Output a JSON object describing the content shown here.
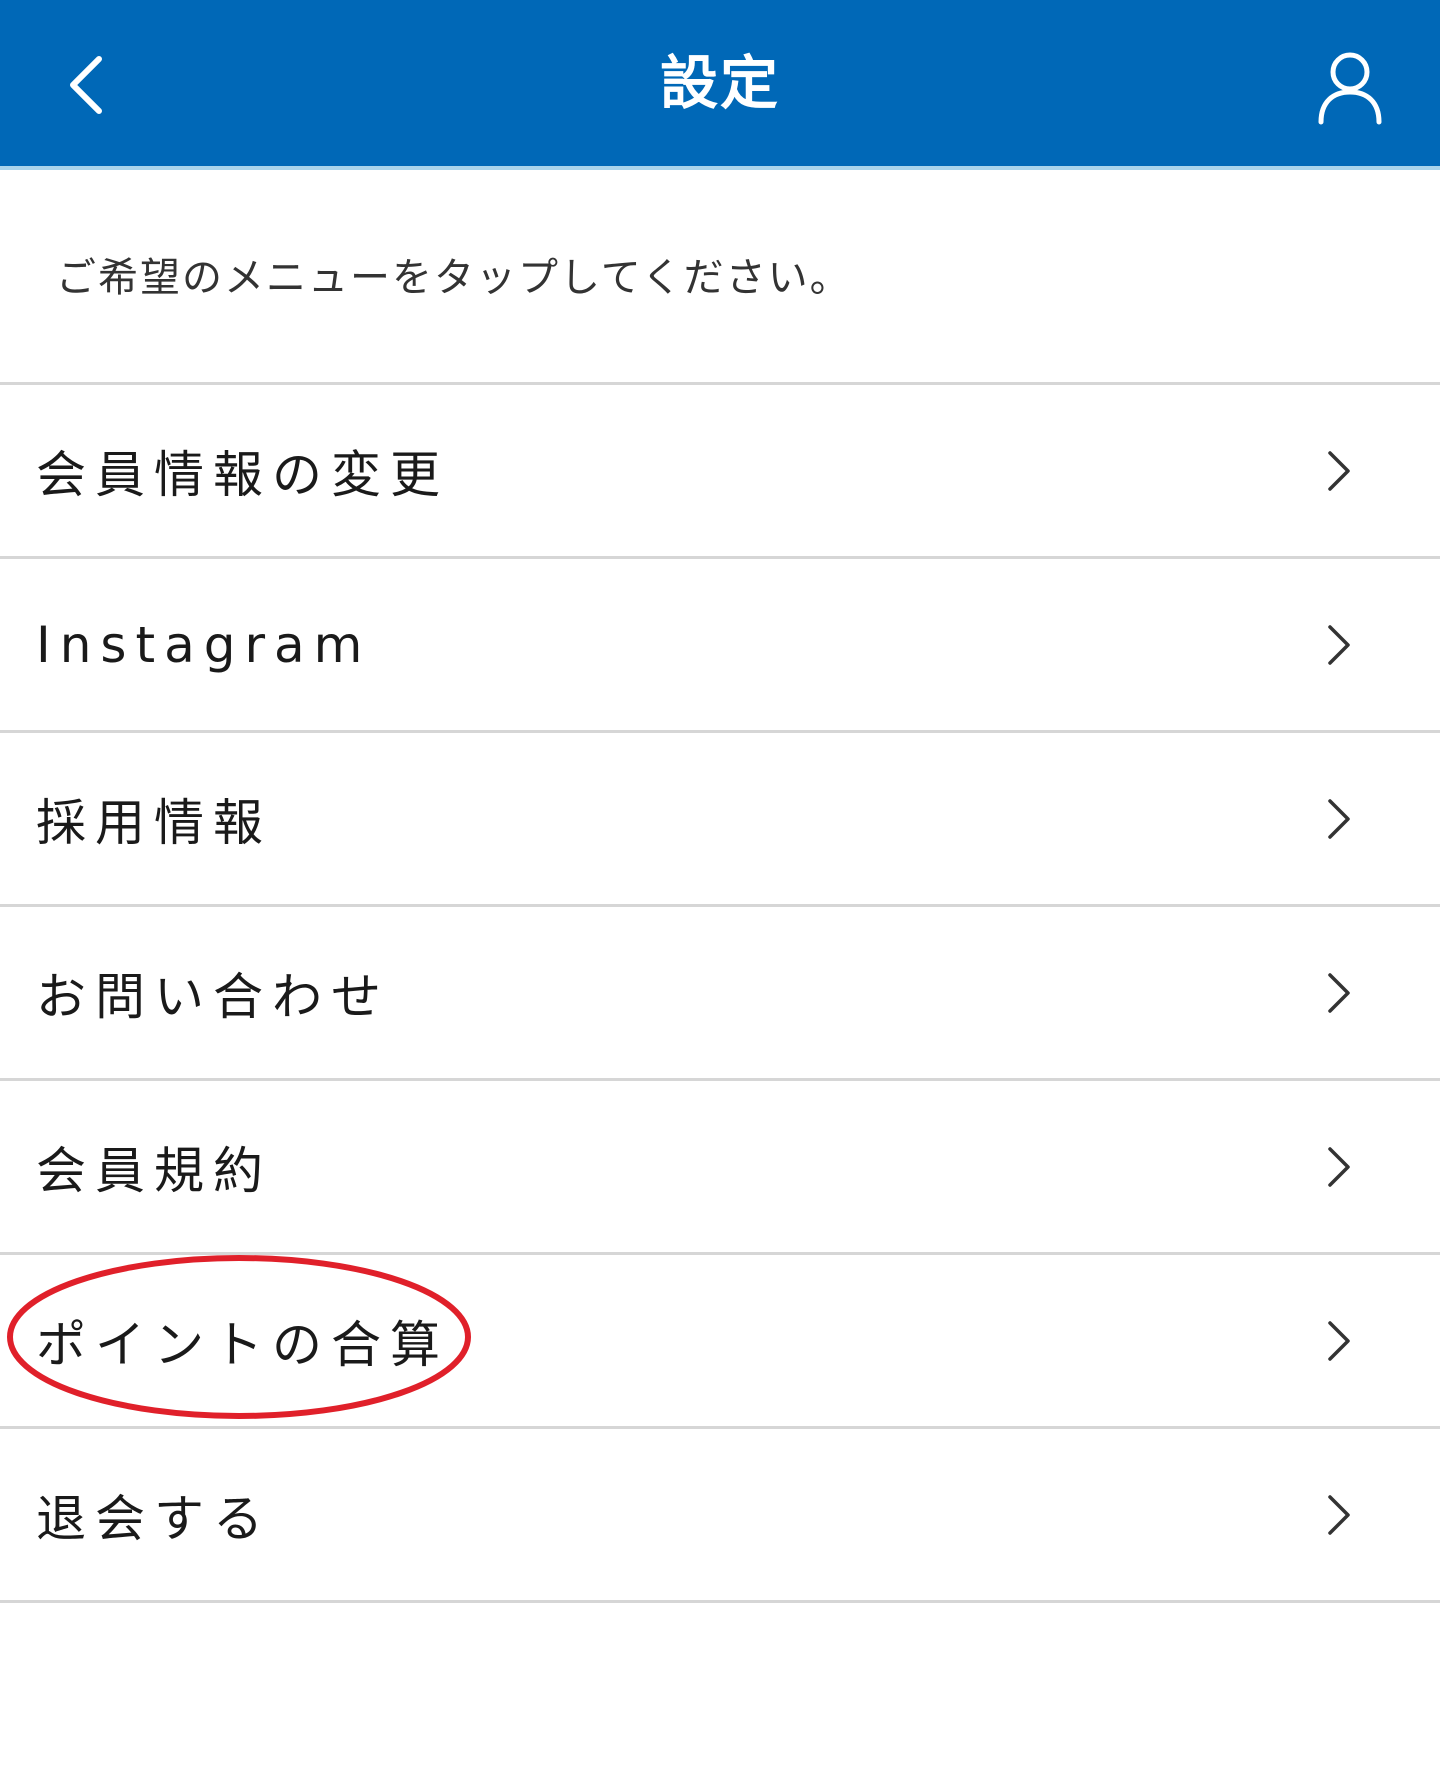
{
  "header": {
    "title": "設定",
    "back_icon": "chevron-left-icon",
    "account_icon": "user-icon",
    "background_color": "#0068b7"
  },
  "instruction": "ご希望のメニューをタップしてください。",
  "menu": {
    "items": [
      {
        "label": "会員情報の変更"
      },
      {
        "label": "Instagram"
      },
      {
        "label": "採用情報"
      },
      {
        "label": "お問い合わせ"
      },
      {
        "label": "会員規約"
      },
      {
        "label": "ポイントの合算"
      },
      {
        "label": "退会する"
      }
    ],
    "chevron_icon": "chevron-right-icon"
  },
  "annotation": {
    "highlighted_item": "ポイントの合算",
    "ring_color": "#e0202a"
  }
}
